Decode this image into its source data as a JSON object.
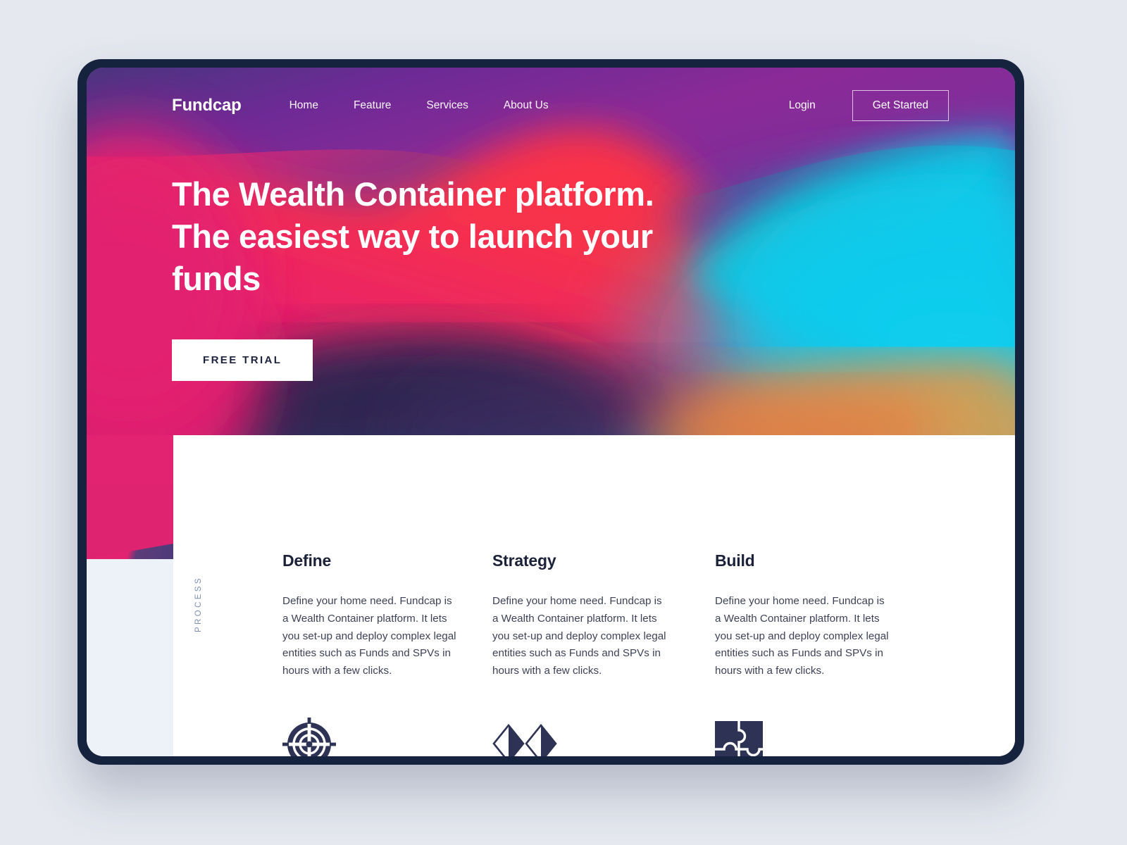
{
  "brand": "Fundcap",
  "nav": {
    "items": [
      {
        "label": "Home"
      },
      {
        "label": "Feature"
      },
      {
        "label": "Services"
      },
      {
        "label": "About Us"
      }
    ],
    "login_label": "Login",
    "cta_label": "Get Started"
  },
  "hero": {
    "title": "The Wealth Container platform. The easiest way to launch your funds",
    "cta_label": "FREE TRIAL"
  },
  "process": {
    "section_label": "PROCESS",
    "columns": [
      {
        "title": "Define",
        "body": "Define your home need. Fundcap is a Wealth Container platform. It lets you set-up and deploy complex legal entities such as Funds and SPVs in hours with a few clicks.",
        "icon": "target-icon"
      },
      {
        "title": "Strategy",
        "body": "Define your home need. Fundcap is a Wealth Container platform. It lets you set-up and deploy complex legal entities such as Funds and SPVs in hours with a few clicks.",
        "icon": "double-diamond-icon"
      },
      {
        "title": "Build",
        "body": "Define your home need. Fundcap is a Wealth Container platform. It lets you set-up and deploy complex legal entities such as Funds and SPVs in hours with a few clicks.",
        "icon": "puzzle-icon"
      }
    ]
  },
  "colors": {
    "page_background": "#e5e8ef",
    "device_bezel": "#16233f",
    "ink": "#1b2138",
    "body_text": "#3d4256",
    "process_label": "#7e8fb5",
    "side_panel": "#edf2f9",
    "hero_pink": "#e32371",
    "hero_red": "#f8314c",
    "hero_purple": "#7b2d9e",
    "hero_cyan": "#0fc6e8",
    "hero_orange": "#e8994a",
    "hero_navy": "#22264f"
  }
}
